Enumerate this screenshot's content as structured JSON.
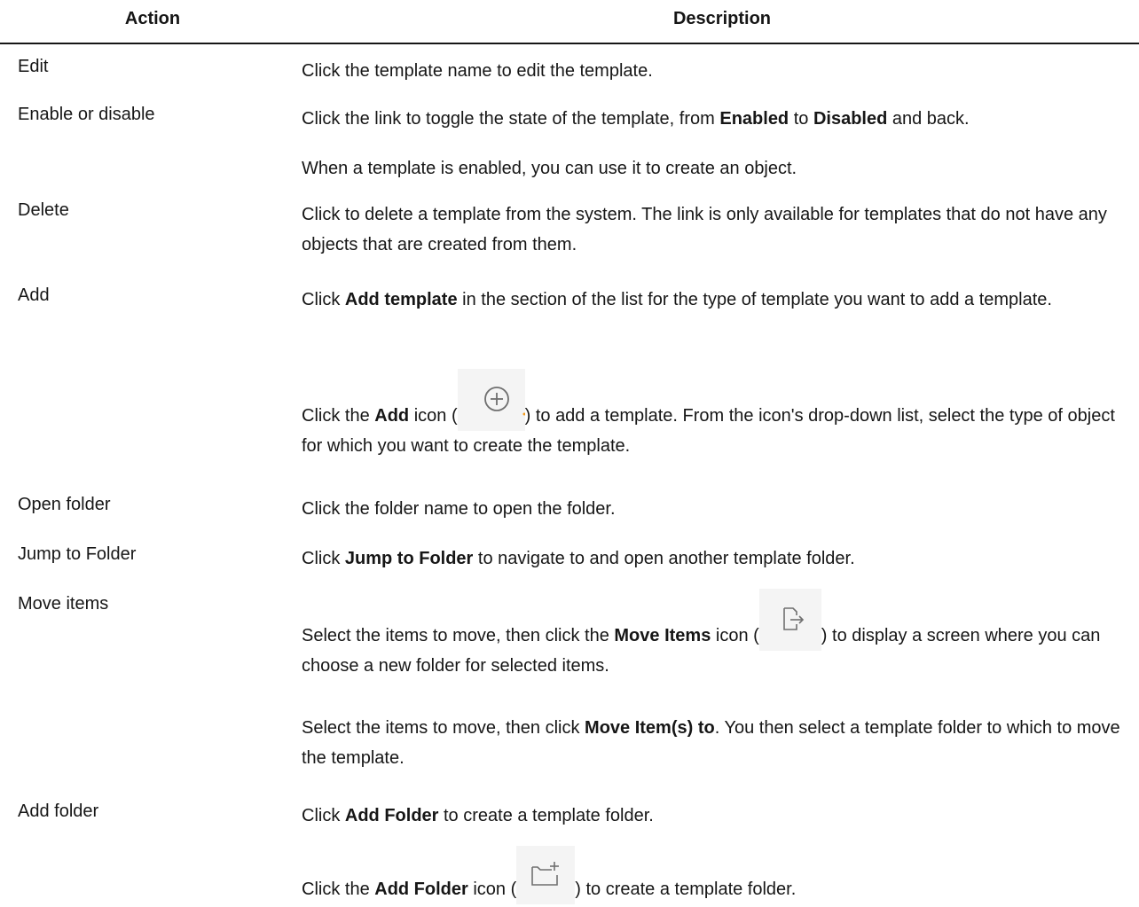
{
  "table": {
    "headers": {
      "action": "Action",
      "description": "Description"
    },
    "rows": {
      "edit": {
        "action": "Edit",
        "p1": "Click the template name to edit the template."
      },
      "enable": {
        "action": "Enable or disable",
        "p1_pre": "Click the link to toggle the state of the template, from ",
        "p1_b1": "Enabled",
        "p1_mid": " to ",
        "p1_b2": "Disabled",
        "p1_post": " and back.",
        "p2": "When a template is enabled, you can use it to create an object."
      },
      "delete": {
        "action": "Delete",
        "p1": "Click to delete a template from the system. The link is only available for templates that do not have any objects that are created from them."
      },
      "add": {
        "action": "Add",
        "p1_pre": "Click ",
        "p1_b": "Add template",
        "p1_post": " in the section of the list for the type of template you want to add a template.",
        "p2_pre": "Click the ",
        "p2_b": "Add",
        "p2_mid": " icon (",
        "p2_post": ") to add a template. From the icon's drop-down list, select the type of object for which you want to create the template.",
        "icon": "add-circle-icon"
      },
      "open_folder": {
        "action": "Open folder",
        "p1": "Click the folder name to open the folder."
      },
      "jump": {
        "action": "Jump to Folder",
        "p1_pre": "Click ",
        "p1_b": "Jump to Folder",
        "p1_post": " to navigate to and open another template folder."
      },
      "move": {
        "action": "Move items",
        "p1_pre": "Select the items to move, then click the ",
        "p1_b": "Move Items",
        "p1_mid": " icon (",
        "p1_post": ") to display a screen where you can choose a new folder for selected items.",
        "p2_pre": "Select the items to move, then click ",
        "p2_b": "Move Item(s) to",
        "p2_post": ". You then select a template folder to which to move the template.",
        "icon": "move-items-icon"
      },
      "add_folder": {
        "action": "Add folder",
        "p1_pre": "Click ",
        "p1_b": "Add Folder",
        "p1_post": " to create a template folder.",
        "p2_pre": "Click the ",
        "p2_b": "Add Folder",
        "p2_mid": " icon (",
        "p2_post": ") to create a template folder.",
        "icon": "add-folder-icon"
      }
    }
  },
  "colors": {
    "text": "#161616",
    "icon_bg": "#f4f4f4",
    "icon_stroke": "#6f6f6f"
  }
}
